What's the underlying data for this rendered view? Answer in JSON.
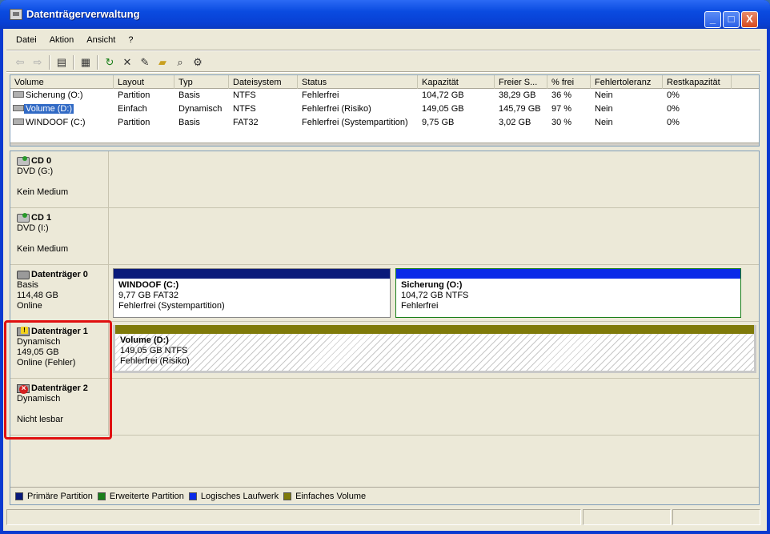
{
  "window": {
    "title": "Datenträgerverwaltung",
    "controls": {
      "minimize": "_",
      "maximize": "□",
      "close": "X"
    }
  },
  "menu": [
    "Datei",
    "Aktion",
    "Ansicht",
    "?"
  ],
  "toolbar": {
    "icons": [
      "back-icon",
      "forward-icon",
      "console-tree-icon",
      "properties-icon",
      "refresh-icon",
      "delete-icon",
      "help-icon",
      "open-icon",
      "search-icon",
      "settings-icon"
    ]
  },
  "list": {
    "columns": [
      "Volume",
      "Layout",
      "Typ",
      "Dateisystem",
      "Status",
      "Kapazität",
      "Freier S...",
      "% frei",
      "Fehlertoleranz",
      "Restkapazität"
    ],
    "rows": [
      [
        "Sicherung (O:)",
        "Partition",
        "Basis",
        "NTFS",
        "Fehlerfrei",
        "104,72 GB",
        "38,29 GB",
        "36 %",
        "Nein",
        "0%"
      ],
      [
        "Volume (D:)",
        "Einfach",
        "Dynamisch",
        "NTFS",
        "Fehlerfrei (Risiko)",
        "149,05 GB",
        "145,79 GB",
        "97 %",
        "Nein",
        "0%"
      ],
      [
        "WINDOOF (C:)",
        "Partition",
        "Basis",
        "FAT32",
        "Fehlerfrei (Systempartition)",
        "9,75 GB",
        "3,02 GB",
        "30 %",
        "Nein",
        "0%"
      ]
    ]
  },
  "disks": [
    {
      "name": "CD 0",
      "line1": "DVD (G:)",
      "line2": "",
      "line3": "Kein Medium"
    },
    {
      "name": "CD 1",
      "line1": "DVD (I:)",
      "line2": "",
      "line3": "Kein Medium"
    },
    {
      "name": "Datenträger 0",
      "line1": "Basis",
      "line2": "114,48 GB",
      "line3": "Online"
    },
    {
      "name": "Datenträger 1",
      "line1": "Dynamisch",
      "line2": "149,05 GB",
      "line3": "Online (Fehler)"
    },
    {
      "name": "Datenträger 2",
      "line1": "Dynamisch",
      "line2": "",
      "line3": "Nicht lesbar"
    }
  ],
  "partitions": {
    "c": {
      "name": "WINDOOF (C:)",
      "size": "9,77 GB FAT32",
      "status": "Fehlerfrei (Systempartition)",
      "color": "#0a1a7a"
    },
    "o": {
      "name": "Sicherung (O:)",
      "size": "104,72 GB NTFS",
      "status": "Fehlerfrei",
      "color": "#0a2ae8"
    },
    "d": {
      "name": "Volume (D:)",
      "size": "149,05 GB NTFS",
      "status": "Fehlerfrei (Risiko)",
      "color": "#7f7a0a"
    }
  },
  "legend": [
    {
      "label": "Primäre Partition",
      "color": "#0a1a7a"
    },
    {
      "label": "Erweiterte Partition",
      "color": "#1a7f1a"
    },
    {
      "label": "Logisches Laufwerk",
      "color": "#0a2ae8"
    },
    {
      "label": "Einfaches Volume",
      "color": "#7f7a0a"
    }
  ]
}
